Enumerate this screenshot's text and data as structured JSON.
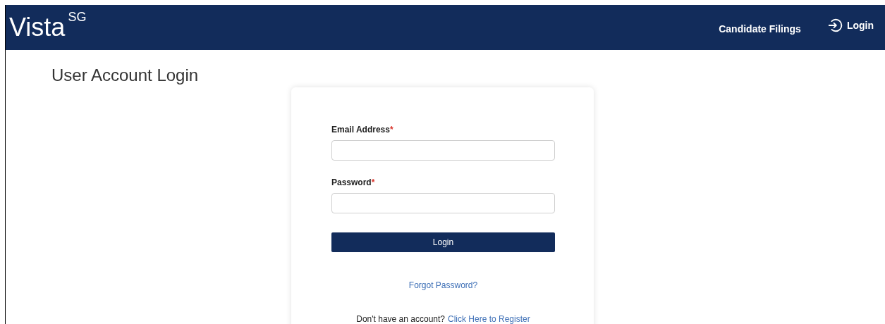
{
  "header": {
    "logo": "Vista",
    "logo_sup": "SG",
    "nav": [
      {
        "label": "Candidate Filings",
        "kind": "link"
      },
      {
        "label": "Login",
        "kind": "login"
      }
    ]
  },
  "page_title": "User Account Login",
  "form": {
    "fields": [
      {
        "label": "Email Address",
        "required": true
      },
      {
        "label": "Password",
        "required": true
      }
    ],
    "required_mark": "*",
    "submit": "Login",
    "forgot": "Forgot Password?",
    "register_text": "Don't have an account?",
    "register_link": "Click Here to Register"
  }
}
